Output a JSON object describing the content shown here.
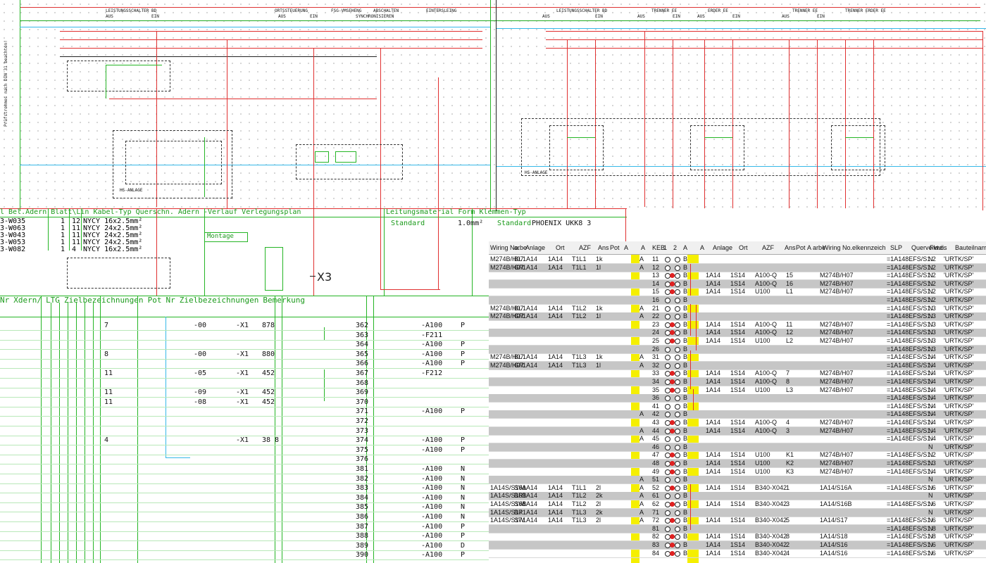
{
  "top": {
    "left_header": [
      "LEISTUNGSSCHALTER BD",
      "AUS",
      "EIN",
      "ORTSSTEUERUNG",
      "FSG-VMSEHENG",
      "ABSCHALTEN",
      "EINTERSLEING",
      "AUS",
      "EIN",
      "SYNCHRONISIEREN"
    ],
    "right_header": [
      "LEISTUNGSSCHALTER BD",
      "AUS",
      "EIN",
      "TRENNER EE",
      "AUS",
      "EIN",
      "ERDER EE",
      "AUS",
      "EIN",
      "TRENNER EE",
      "AUS",
      "EIN",
      "TRENNER ERDER EE"
    ],
    "side_label": "Prüfstrommes nach DIN 31 beachten!",
    "x3_label": "X3",
    "hs_anlage": "HS-ANLAGE"
  },
  "cable_table": {
    "header": "l Bel.Adern Blatt\\Lin Kabel-Typ Querschn. Adern -Verlauf Verlegungsplan",
    "header_right": "Leitungsmaterial    Form Klemmen-Typ",
    "montage": "Montage",
    "standard_label": "Standard",
    "wire_spec": "1.0mm²",
    "terminal_type": "PHOENIX UKK8 3",
    "rows": [
      {
        "id": "3-W035",
        "a": "1",
        "b": "12",
        "type": "NYCY 16x2.5mm²"
      },
      {
        "id": "3-W063",
        "a": "1",
        "b": "11",
        "type": "NYCY 24x2.5mm²"
      },
      {
        "id": "3-W043",
        "a": "1",
        "b": "11",
        "type": "NYCY 24x2.5mm²"
      },
      {
        "id": "3-W053",
        "a": "1",
        "b": "11",
        "type": "NYCY 24x2.5mm²"
      },
      {
        "id": "3-W082",
        "a": "1",
        "b": "4",
        "type": "NYCY 16x2.5mm²"
      }
    ]
  },
  "terminal_table": {
    "headers": {
      "nr": "Nr",
      "adern": "Xdern/",
      "ltg": "LTG",
      "ziel1": "Zielbezeichnungen",
      "pot": "Pot",
      "nr2": "Nr",
      "ziel2": "Zielbezeichnungen",
      "bem": "Bemerkung"
    },
    "rows": [
      {
        "a": "7",
        "c": "-00",
        "d": "-X1",
        "e": "878",
        "n": "362",
        "f": "-A100",
        "p": "P"
      },
      {
        "a": "",
        "c": "",
        "d": "",
        "e": "",
        "n": "363",
        "f": "-F211",
        "p": ""
      },
      {
        "a": "",
        "c": "",
        "d": "",
        "e": "",
        "n": "364",
        "f": "-A100",
        "p": "P"
      },
      {
        "a": "8",
        "c": "-00",
        "d": "-X1",
        "e": "880",
        "n": "365",
        "f": "-A100",
        "p": "P"
      },
      {
        "a": "",
        "c": "",
        "d": "",
        "e": "",
        "n": "366",
        "f": "-A100",
        "p": "P"
      },
      {
        "a": "11",
        "c": "-05",
        "d": "-X1",
        "e": "452",
        "n": "367",
        "f": "-F212",
        "p": ""
      },
      {
        "a": "",
        "c": "",
        "d": "",
        "e": "",
        "n": "368",
        "f": "",
        "p": ""
      },
      {
        "a": "11",
        "c": "-09",
        "d": "-X1",
        "e": "452",
        "n": "369",
        "f": "",
        "p": ""
      },
      {
        "a": "11",
        "c": "-08",
        "d": "-X1",
        "e": "452",
        "n": "370",
        "f": "",
        "p": ""
      },
      {
        "a": "",
        "c": "",
        "d": "",
        "e": "",
        "n": "371",
        "f": "-A100",
        "p": "P"
      },
      {
        "a": "",
        "c": "",
        "d": "",
        "e": "",
        "n": "372",
        "f": "",
        "p": ""
      },
      {
        "a": "",
        "c": "",
        "d": "",
        "e": "",
        "n": "373",
        "f": "",
        "p": ""
      },
      {
        "a": "4",
        "c": "",
        "d": "-X1",
        "e": "38 8",
        "n": "374",
        "f": "-A100",
        "p": "P"
      },
      {
        "a": "",
        "c": "",
        "d": "",
        "e": "",
        "n": "375",
        "f": "-A100",
        "p": "P"
      },
      {
        "a": "",
        "c": "",
        "d": "",
        "e": "",
        "n": "376",
        "f": "",
        "p": ""
      },
      {
        "a": "",
        "c": "",
        "d": "",
        "e": "",
        "n": "381",
        "f": "-A100",
        "p": "N"
      },
      {
        "a": "",
        "c": "",
        "d": "",
        "e": "",
        "n": "382",
        "f": "-A100",
        "p": "N"
      },
      {
        "a": "",
        "c": "",
        "d": "",
        "e": "",
        "n": "383",
        "f": "-A100",
        "p": "N"
      },
      {
        "a": "",
        "c": "",
        "d": "",
        "e": "",
        "n": "384",
        "f": "-A100",
        "p": "N"
      },
      {
        "a": "",
        "c": "",
        "d": "",
        "e": "",
        "n": "385",
        "f": "-A100",
        "p": "N"
      },
      {
        "a": "",
        "c": "",
        "d": "",
        "e": "",
        "n": "386",
        "f": "-A100",
        "p": "N"
      },
      {
        "a": "",
        "c": "",
        "d": "",
        "e": "",
        "n": "387",
        "f": "-A100",
        "p": "P"
      },
      {
        "a": "",
        "c": "",
        "d": "",
        "e": "",
        "n": "388",
        "f": "-A100",
        "p": "P"
      },
      {
        "a": "",
        "c": "",
        "d": "",
        "e": "",
        "n": "389",
        "f": "-A100",
        "p": "D"
      },
      {
        "a": "",
        "c": "",
        "d": "",
        "e": "",
        "n": "390",
        "f": "-A100",
        "p": "P"
      }
    ]
  },
  "grid": {
    "headers": [
      "Wiring No.",
      "arbe",
      "Anlage",
      "Ort",
      "AZF",
      "Ans",
      "Pot",
      "A",
      "A",
      "KEB",
      "1",
      "2",
      "A",
      "A",
      "Anlage",
      "Ort",
      "AZF",
      "Ans",
      "Pot",
      "A",
      "arbe",
      "Wiring No.",
      "elkennzeich",
      "SLP",
      "Querverweis",
      "Fkt.ö.",
      "Bauteilname"
    ],
    "rows": [
      {
        "g": false,
        "w": "M274B/H07",
        "arb": "BL",
        "an": "1A14",
        "ort": "1A14",
        "azf": "T1L1",
        "ans": "1k",
        "a1": "A",
        "k": "11",
        "r1": "",
        "r2": "",
        "w2": "",
        "q": "=1A148EFS/S1.2",
        "f": "N",
        "b": "'URTK/SP'"
      },
      {
        "g": true,
        "w": "M274B/H07",
        "arb": "GR",
        "an": "1A14",
        "ort": "1A14",
        "azf": "T1L1",
        "ans": "1l",
        "a1": "A",
        "k": "12",
        "r1": "",
        "r2": "",
        "w2": "",
        "q": "=1A148EFS/S1.2",
        "f": "N",
        "b": "'URTK/SP'"
      },
      {
        "g": false,
        "w": "",
        "arb": "",
        "an": "",
        "ort": "",
        "azf": "",
        "ans": "",
        "a1": "",
        "k": "13",
        "r1": "1A14",
        "r2": "1S14",
        "rz": "A100-Q",
        "rn": "15",
        "w2": "M274B/H07",
        "q": "=1A148EFS/S1.2",
        "f": "N",
        "b": "'URTK/SP'"
      },
      {
        "g": true,
        "w": "",
        "arb": "",
        "an": "",
        "ort": "",
        "azf": "",
        "ans": "",
        "a1": "",
        "k": "14",
        "r1": "1A14",
        "r2": "1S14",
        "rz": "A100-Q",
        "rn": "16",
        "w2": "M274B/H07",
        "q": "=1A148EFS/S1.2",
        "f": "N",
        "b": "'URTK/SP'"
      },
      {
        "g": false,
        "w": "",
        "arb": "",
        "an": "",
        "ort": "",
        "azf": "",
        "ans": "",
        "a1": "",
        "k": "15",
        "r1": "1A14",
        "r2": "1S14",
        "rz": "U100",
        "rn": "L1",
        "w2": "M274B/H07",
        "q": "=1A148EFS/S1.2",
        "f": "N",
        "b": "'URTK/SP'"
      },
      {
        "g": true,
        "w": "",
        "arb": "",
        "an": "",
        "ort": "",
        "azf": "",
        "ans": "",
        "a1": "",
        "k": "16",
        "r1": "",
        "r2": "",
        "rz": "",
        "rn": "",
        "w2": "",
        "q": "=1A148EFS/S1.2",
        "f": "N",
        "b": "'URTK/SP'"
      },
      {
        "g": false,
        "w": "M274B/H07",
        "arb": "BL",
        "an": "1A14",
        "ort": "1A14",
        "azf": "T1L2",
        "ans": "1k",
        "a1": "A",
        "k": "21",
        "r1": "",
        "r2": "",
        "w2": "",
        "q": "=1A148EFS/S1.3",
        "f": "N",
        "b": "'URTK/SP'"
      },
      {
        "g": true,
        "w": "M274B/H07",
        "arb": "GR",
        "an": "1A14",
        "ort": "1A14",
        "azf": "T1L2",
        "ans": "1l",
        "a1": "A",
        "k": "22",
        "r1": "",
        "r2": "",
        "w2": "",
        "q": "=1A148EFS/S1.3",
        "f": "N",
        "b": "'URTK/SP'"
      },
      {
        "g": false,
        "w": "",
        "arb": "",
        "an": "",
        "ort": "",
        "azf": "",
        "ans": "",
        "a1": "",
        "k": "23",
        "r1": "1A14",
        "r2": "1S14",
        "rz": "A100-Q",
        "rn": "11",
        "w2": "M274B/H07",
        "q": "=1A148EFS/S1.3",
        "f": "N",
        "b": "'URTK/SP'"
      },
      {
        "g": true,
        "w": "",
        "arb": "",
        "an": "",
        "ort": "",
        "azf": "",
        "ans": "",
        "a1": "",
        "k": "24",
        "r1": "1A14",
        "r2": "1S14",
        "rz": "A100-Q",
        "rn": "12",
        "w2": "M274B/H07",
        "q": "=1A148EFS/S1.3",
        "f": "N",
        "b": "'URTK/SP'"
      },
      {
        "g": false,
        "w": "",
        "arb": "",
        "an": "",
        "ort": "",
        "azf": "",
        "ans": "",
        "a1": "",
        "k": "25",
        "r1": "1A14",
        "r2": "1S14",
        "rz": "U100",
        "rn": "L2",
        "w2": "M274B/H07",
        "q": "=1A148EFS/S1.3",
        "f": "N",
        "b": "'URTK/SP'"
      },
      {
        "g": true,
        "w": "",
        "arb": "",
        "an": "",
        "ort": "",
        "azf": "",
        "ans": "",
        "a1": "",
        "k": "26",
        "r1": "",
        "r2": "",
        "rz": "",
        "rn": "",
        "w2": "",
        "q": "=1A148EFS/S1.3",
        "f": "N",
        "b": "'URTK/SP'"
      },
      {
        "g": false,
        "w": "M274B/H07",
        "arb": "BL",
        "an": "1A14",
        "ort": "1A14",
        "azf": "T1L3",
        "ans": "1k",
        "a1": "A",
        "k": "31",
        "r1": "",
        "r2": "",
        "w2": "",
        "q": "=1A148EFS/S1.4",
        "f": "N",
        "b": "'URTK/SP'"
      },
      {
        "g": true,
        "w": "M274B/H07",
        "arb": "GR",
        "an": "1A14",
        "ort": "1A14",
        "azf": "T1L3",
        "ans": "1l",
        "a1": "A",
        "k": "32",
        "r1": "",
        "r2": "",
        "w2": "",
        "q": "=1A148EFS/S1.4",
        "f": "N",
        "b": "'URTK/SP'"
      },
      {
        "g": false,
        "w": "",
        "arb": "",
        "an": "",
        "ort": "",
        "azf": "",
        "ans": "",
        "a1": "",
        "k": "33",
        "r1": "1A14",
        "r2": "1S14",
        "rz": "A100-Q",
        "rn": "7",
        "w2": "M274B/H07",
        "q": "=1A148EFS/S1.4",
        "f": "N",
        "b": "'URTK/SP'"
      },
      {
        "g": true,
        "w": "",
        "arb": "",
        "an": "",
        "ort": "",
        "azf": "",
        "ans": "",
        "a1": "",
        "k": "34",
        "r1": "1A14",
        "r2": "1S14",
        "rz": "A100-Q",
        "rn": "8",
        "w2": "M274B/H07",
        "q": "=1A148EFS/S1.4",
        "f": "N",
        "b": "'URTK/SP'"
      },
      {
        "g": false,
        "w": "",
        "arb": "",
        "an": "",
        "ort": "",
        "azf": "",
        "ans": "",
        "a1": "",
        "k": "35",
        "r1": "1A14",
        "r2": "1S14",
        "rz": "U100",
        "rn": "L3",
        "w2": "M274B/H07",
        "q": "=1A148EFS/S1.4",
        "f": "N",
        "b": "'URTK/SP'"
      },
      {
        "g": true,
        "w": "",
        "arb": "",
        "an": "",
        "ort": "",
        "azf": "",
        "ans": "",
        "a1": "",
        "k": "36",
        "r1": "",
        "r2": "",
        "rz": "",
        "rn": "",
        "w2": "",
        "q": "=1A148EFS/S1.4",
        "f": "N",
        "b": "'URTK/SP'"
      },
      {
        "g": false,
        "w": "",
        "arb": "",
        "an": "",
        "ort": "",
        "azf": "",
        "ans": "",
        "a1": "",
        "k": "41",
        "r1": "",
        "r2": "",
        "rz": "",
        "rn": "",
        "w2": "",
        "q": "=1A148EFS/S1.4",
        "f": "N",
        "b": "'URTK/SP'"
      },
      {
        "g": true,
        "w": "",
        "arb": "",
        "an": "",
        "ort": "",
        "azf": "",
        "ans": "",
        "a1": "A",
        "k": "42",
        "r1": "",
        "r2": "",
        "rz": "",
        "rn": "",
        "w2": "",
        "q": "=1A148EFS/S1.4",
        "f": "N",
        "b": "'URTK/SP'"
      },
      {
        "g": false,
        "w": "",
        "arb": "",
        "an": "",
        "ort": "",
        "azf": "",
        "ans": "",
        "a1": "",
        "k": "43",
        "r1": "1A14",
        "r2": "1S14",
        "rz": "A100-Q",
        "rn": "4",
        "w2": "M274B/H07",
        "q": "=1A148EFS/S1.4",
        "f": "N",
        "b": "'URTK/SP'"
      },
      {
        "g": true,
        "w": "",
        "arb": "",
        "an": "",
        "ort": "",
        "azf": "",
        "ans": "",
        "a1": "A",
        "k": "44",
        "r1": "1A14",
        "r2": "1S14",
        "rz": "A100-Q",
        "rn": "3",
        "w2": "M274B/H07",
        "q": "=1A148EFS/S1.4",
        "f": "N",
        "b": "'URTK/SP'"
      },
      {
        "g": false,
        "w": "",
        "arb": "",
        "an": "",
        "ort": "",
        "azf": "",
        "ans": "",
        "a1": "A",
        "k": "45",
        "r1": "",
        "r2": "",
        "rz": "",
        "rn": "",
        "w2": "",
        "q": "=1A148EFS/S1.4",
        "f": "N",
        "b": "'URTK/SP'"
      },
      {
        "g": true,
        "w": "",
        "arb": "",
        "an": "",
        "ort": "",
        "azf": "",
        "ans": "",
        "a1": "",
        "k": "46",
        "r1": "",
        "r2": "",
        "rz": "",
        "rn": "",
        "w2": "",
        "q": "",
        "f": "N",
        "b": "'URTK/SP'"
      },
      {
        "g": false,
        "w": "",
        "arb": "",
        "an": "",
        "ort": "",
        "azf": "",
        "ans": "",
        "a1": "",
        "k": "47",
        "r1": "1A14",
        "r2": "1S14",
        "rz": "U100",
        "rn": "K1",
        "w2": "M274B/H07",
        "q": "=1A148EFS/S1.2",
        "f": "N",
        "b": "'URTK/SP'"
      },
      {
        "g": true,
        "w": "",
        "arb": "",
        "an": "",
        "ort": "",
        "azf": "",
        "ans": "",
        "a1": "",
        "k": "48",
        "r1": "1A14",
        "r2": "1S14",
        "rz": "U100",
        "rn": "K2",
        "w2": "M274B/H07",
        "q": "=1A148EFS/S1.3",
        "f": "N",
        "b": "'URTK/SP'"
      },
      {
        "g": false,
        "w": "",
        "arb": "",
        "an": "",
        "ort": "",
        "azf": "",
        "ans": "",
        "a1": "",
        "k": "49",
        "r1": "1A14",
        "r2": "1S14",
        "rz": "U100",
        "rn": "K3",
        "w2": "M274B/H07",
        "q": "=1A148EFS/S1.4",
        "f": "N",
        "b": "'URTK/SP'"
      },
      {
        "g": true,
        "w": "",
        "arb": "",
        "an": "",
        "ort": "",
        "azf": "",
        "ans": "",
        "a1": "A",
        "k": "51",
        "r1": "",
        "r2": "",
        "rz": "",
        "rn": "",
        "w2": "",
        "q": "",
        "f": "N",
        "b": "'URTK/SP'"
      },
      {
        "g": false,
        "w": "1A14S/S16A",
        "arb": "SW",
        "an": "1A14",
        "ort": "1A14",
        "azf": "T1L1",
        "ans": "2l",
        "a1": "A",
        "k": "52",
        "r1": "1A14",
        "r2": "1S14",
        "rz": "B340-X042",
        "rn": "1",
        "w2": "1A14/S16A",
        "q": "=1A148EFS/S1.6",
        "f": "N",
        "b": "'URTK/SP'"
      },
      {
        "g": true,
        "w": "1A14S/S16B",
        "arb": "BR",
        "an": "1A14",
        "ort": "1A14",
        "azf": "T1L2",
        "ans": "2k",
        "a1": "A",
        "k": "61",
        "r1": "",
        "r2": "",
        "rz": "",
        "rn": "",
        "w2": "",
        "q": "",
        "f": "N",
        "b": "'URTK/SP'"
      },
      {
        "g": false,
        "w": "1A14S/S16B",
        "arb": "SW",
        "an": "1A14",
        "ort": "1A14",
        "azf": "T1L2",
        "ans": "2l",
        "a1": "A",
        "k": "62",
        "r1": "1A14",
        "r2": "1S14",
        "rz": "B340-X042",
        "rn": "3",
        "w2": "1A14/S16B",
        "q": "=1A148EFS/S1.6",
        "f": "N",
        "b": "'URTK/SP'"
      },
      {
        "g": true,
        "w": "1A14S/S17",
        "arb": "BR",
        "an": "1A14",
        "ort": "1A14",
        "azf": "T1L3",
        "ans": "2k",
        "a1": "A",
        "k": "71",
        "r1": "",
        "r2": "",
        "rz": "",
        "rn": "",
        "w2": "",
        "q": "",
        "f": "N",
        "b": "'URTK/SP'"
      },
      {
        "g": false,
        "w": "1A14S/S17",
        "arb": "SW",
        "an": "1A14",
        "ort": "1A14",
        "azf": "T1L3",
        "ans": "2l",
        "a1": "A",
        "k": "72",
        "r1": "1A14",
        "r2": "1S14",
        "rz": "B340-X042",
        "rn": "5",
        "w2": "1A14/S17",
        "q": "=1A148EFS/S1.6",
        "f": "N",
        "b": "'URTK/SP'"
      },
      {
        "g": true,
        "w": "",
        "arb": "",
        "an": "",
        "ort": "",
        "azf": "",
        "ans": "",
        "a1": "",
        "k": "81",
        "r1": "",
        "r2": "",
        "rz": "",
        "rn": "",
        "w2": "",
        "q": "=1A148EFS/S1.8",
        "f": "N",
        "b": "'URTK/SP'"
      },
      {
        "g": false,
        "w": "",
        "arb": "",
        "an": "",
        "ort": "",
        "azf": "",
        "ans": "",
        "a1": "",
        "k": "82",
        "r1": "1A14",
        "r2": "1S14",
        "rz": "B340-X042",
        "rn": "8",
        "w2": "1A14/S18",
        "q": "=1A148EFS/S1.8",
        "f": "N",
        "b": "'URTK/SP'"
      },
      {
        "g": true,
        "w": "",
        "arb": "",
        "an": "",
        "ort": "",
        "azf": "",
        "ans": "",
        "a1": "",
        "k": "83",
        "r1": "1A14",
        "r2": "1S14",
        "rz": "B340-X042",
        "rn": "2",
        "w2": "1A14/S16",
        "q": "=1A148EFS/S1.6",
        "f": "N",
        "b": "'URTK/SP'"
      },
      {
        "g": false,
        "w": "",
        "arb": "",
        "an": "",
        "ort": "",
        "azf": "",
        "ans": "",
        "a1": "",
        "k": "84",
        "r1": "1A14",
        "r2": "1S14",
        "rz": "B340-X042",
        "rn": "4",
        "w2": "1A14/S16",
        "q": "=1A148EFS/S1.6",
        "f": "N",
        "b": "'URTK/SP'"
      }
    ]
  }
}
